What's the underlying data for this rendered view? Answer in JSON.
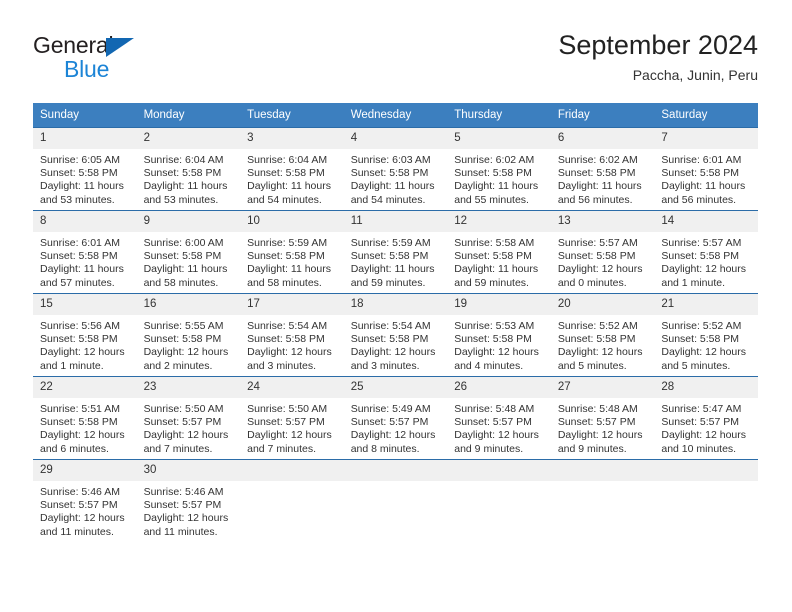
{
  "brand": {
    "name_top": "General",
    "name_bottom": "Blue",
    "triangle_color": "#1267b2",
    "blue_text_color": "#1c84d6"
  },
  "header": {
    "title": "September 2024",
    "subtitle": "Paccha, Junin, Peru"
  },
  "theme": {
    "header_row_bg": "#3c7fbf",
    "week_divider": "#2b6ca8",
    "day_number_bg": "#f0f0f0",
    "text": "#333333"
  },
  "weekday_headers": [
    "Sunday",
    "Monday",
    "Tuesday",
    "Wednesday",
    "Thursday",
    "Friday",
    "Saturday"
  ],
  "labels": {
    "sunrise_prefix": "Sunrise:",
    "sunset_prefix": "Sunset:",
    "daylight_prefix": "Daylight:"
  },
  "weeks": [
    [
      {
        "day": "1",
        "sunrise": "Sunrise: 6:05 AM",
        "sunset": "Sunset: 5:58 PM",
        "daylight_line1": "Daylight: 11 hours",
        "daylight_line2": "and 53 minutes."
      },
      {
        "day": "2",
        "sunrise": "Sunrise: 6:04 AM",
        "sunset": "Sunset: 5:58 PM",
        "daylight_line1": "Daylight: 11 hours",
        "daylight_line2": "and 53 minutes."
      },
      {
        "day": "3",
        "sunrise": "Sunrise: 6:04 AM",
        "sunset": "Sunset: 5:58 PM",
        "daylight_line1": "Daylight: 11 hours",
        "daylight_line2": "and 54 minutes."
      },
      {
        "day": "4",
        "sunrise": "Sunrise: 6:03 AM",
        "sunset": "Sunset: 5:58 PM",
        "daylight_line1": "Daylight: 11 hours",
        "daylight_line2": "and 54 minutes."
      },
      {
        "day": "5",
        "sunrise": "Sunrise: 6:02 AM",
        "sunset": "Sunset: 5:58 PM",
        "daylight_line1": "Daylight: 11 hours",
        "daylight_line2": "and 55 minutes."
      },
      {
        "day": "6",
        "sunrise": "Sunrise: 6:02 AM",
        "sunset": "Sunset: 5:58 PM",
        "daylight_line1": "Daylight: 11 hours",
        "daylight_line2": "and 56 minutes."
      },
      {
        "day": "7",
        "sunrise": "Sunrise: 6:01 AM",
        "sunset": "Sunset: 5:58 PM",
        "daylight_line1": "Daylight: 11 hours",
        "daylight_line2": "and 56 minutes."
      }
    ],
    [
      {
        "day": "8",
        "sunrise": "Sunrise: 6:01 AM",
        "sunset": "Sunset: 5:58 PM",
        "daylight_line1": "Daylight: 11 hours",
        "daylight_line2": "and 57 minutes."
      },
      {
        "day": "9",
        "sunrise": "Sunrise: 6:00 AM",
        "sunset": "Sunset: 5:58 PM",
        "daylight_line1": "Daylight: 11 hours",
        "daylight_line2": "and 58 minutes."
      },
      {
        "day": "10",
        "sunrise": "Sunrise: 5:59 AM",
        "sunset": "Sunset: 5:58 PM",
        "daylight_line1": "Daylight: 11 hours",
        "daylight_line2": "and 58 minutes."
      },
      {
        "day": "11",
        "sunrise": "Sunrise: 5:59 AM",
        "sunset": "Sunset: 5:58 PM",
        "daylight_line1": "Daylight: 11 hours",
        "daylight_line2": "and 59 minutes."
      },
      {
        "day": "12",
        "sunrise": "Sunrise: 5:58 AM",
        "sunset": "Sunset: 5:58 PM",
        "daylight_line1": "Daylight: 11 hours",
        "daylight_line2": "and 59 minutes."
      },
      {
        "day": "13",
        "sunrise": "Sunrise: 5:57 AM",
        "sunset": "Sunset: 5:58 PM",
        "daylight_line1": "Daylight: 12 hours",
        "daylight_line2": "and 0 minutes."
      },
      {
        "day": "14",
        "sunrise": "Sunrise: 5:57 AM",
        "sunset": "Sunset: 5:58 PM",
        "daylight_line1": "Daylight: 12 hours",
        "daylight_line2": "and 1 minute."
      }
    ],
    [
      {
        "day": "15",
        "sunrise": "Sunrise: 5:56 AM",
        "sunset": "Sunset: 5:58 PM",
        "daylight_line1": "Daylight: 12 hours",
        "daylight_line2": "and 1 minute."
      },
      {
        "day": "16",
        "sunrise": "Sunrise: 5:55 AM",
        "sunset": "Sunset: 5:58 PM",
        "daylight_line1": "Daylight: 12 hours",
        "daylight_line2": "and 2 minutes."
      },
      {
        "day": "17",
        "sunrise": "Sunrise: 5:54 AM",
        "sunset": "Sunset: 5:58 PM",
        "daylight_line1": "Daylight: 12 hours",
        "daylight_line2": "and 3 minutes."
      },
      {
        "day": "18",
        "sunrise": "Sunrise: 5:54 AM",
        "sunset": "Sunset: 5:58 PM",
        "daylight_line1": "Daylight: 12 hours",
        "daylight_line2": "and 3 minutes."
      },
      {
        "day": "19",
        "sunrise": "Sunrise: 5:53 AM",
        "sunset": "Sunset: 5:58 PM",
        "daylight_line1": "Daylight: 12 hours",
        "daylight_line2": "and 4 minutes."
      },
      {
        "day": "20",
        "sunrise": "Sunrise: 5:52 AM",
        "sunset": "Sunset: 5:58 PM",
        "daylight_line1": "Daylight: 12 hours",
        "daylight_line2": "and 5 minutes."
      },
      {
        "day": "21",
        "sunrise": "Sunrise: 5:52 AM",
        "sunset": "Sunset: 5:58 PM",
        "daylight_line1": "Daylight: 12 hours",
        "daylight_line2": "and 5 minutes."
      }
    ],
    [
      {
        "day": "22",
        "sunrise": "Sunrise: 5:51 AM",
        "sunset": "Sunset: 5:58 PM",
        "daylight_line1": "Daylight: 12 hours",
        "daylight_line2": "and 6 minutes."
      },
      {
        "day": "23",
        "sunrise": "Sunrise: 5:50 AM",
        "sunset": "Sunset: 5:57 PM",
        "daylight_line1": "Daylight: 12 hours",
        "daylight_line2": "and 7 minutes."
      },
      {
        "day": "24",
        "sunrise": "Sunrise: 5:50 AM",
        "sunset": "Sunset: 5:57 PM",
        "daylight_line1": "Daylight: 12 hours",
        "daylight_line2": "and 7 minutes."
      },
      {
        "day": "25",
        "sunrise": "Sunrise: 5:49 AM",
        "sunset": "Sunset: 5:57 PM",
        "daylight_line1": "Daylight: 12 hours",
        "daylight_line2": "and 8 minutes."
      },
      {
        "day": "26",
        "sunrise": "Sunrise: 5:48 AM",
        "sunset": "Sunset: 5:57 PM",
        "daylight_line1": "Daylight: 12 hours",
        "daylight_line2": "and 9 minutes."
      },
      {
        "day": "27",
        "sunrise": "Sunrise: 5:48 AM",
        "sunset": "Sunset: 5:57 PM",
        "daylight_line1": "Daylight: 12 hours",
        "daylight_line2": "and 9 minutes."
      },
      {
        "day": "28",
        "sunrise": "Sunrise: 5:47 AM",
        "sunset": "Sunset: 5:57 PM",
        "daylight_line1": "Daylight: 12 hours",
        "daylight_line2": "and 10 minutes."
      }
    ],
    [
      {
        "day": "29",
        "sunrise": "Sunrise: 5:46 AM",
        "sunset": "Sunset: 5:57 PM",
        "daylight_line1": "Daylight: 12 hours",
        "daylight_line2": "and 11 minutes."
      },
      {
        "day": "30",
        "sunrise": "Sunrise: 5:46 AM",
        "sunset": "Sunset: 5:57 PM",
        "daylight_line1": "Daylight: 12 hours",
        "daylight_line2": "and 11 minutes."
      },
      {
        "day": "",
        "sunrise": "",
        "sunset": "",
        "daylight_line1": "",
        "daylight_line2": ""
      },
      {
        "day": "",
        "sunrise": "",
        "sunset": "",
        "daylight_line1": "",
        "daylight_line2": ""
      },
      {
        "day": "",
        "sunrise": "",
        "sunset": "",
        "daylight_line1": "",
        "daylight_line2": ""
      },
      {
        "day": "",
        "sunrise": "",
        "sunset": "",
        "daylight_line1": "",
        "daylight_line2": ""
      },
      {
        "day": "",
        "sunrise": "",
        "sunset": "",
        "daylight_line1": "",
        "daylight_line2": ""
      }
    ]
  ]
}
